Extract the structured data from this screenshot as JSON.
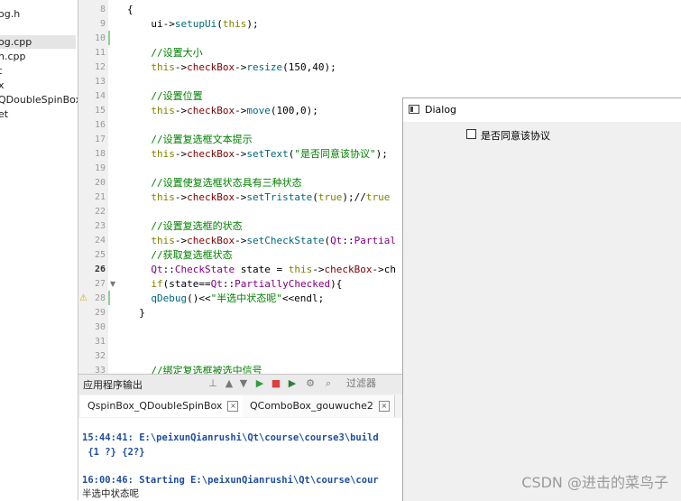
{
  "sidebar": {
    "files": [
      "og.h",
      "og.cpp",
      "n.cpp",
      "t",
      "x",
      "QDoubleSpinBox",
      "et"
    ]
  },
  "editor": {
    "lines": [
      {
        "n": "8",
        "text": "{"
      },
      {
        "n": "9",
        "text": "ui->setupUi(this);"
      },
      {
        "n": "10",
        "text": ""
      },
      {
        "n": "11",
        "text": "//设置大小"
      },
      {
        "n": "12",
        "text": "this->checkBox->resize(150,40);"
      },
      {
        "n": "13",
        "text": ""
      },
      {
        "n": "14",
        "text": "//设置位置"
      },
      {
        "n": "15",
        "text": "this->checkBox->move(100,0);"
      },
      {
        "n": "16",
        "text": ""
      },
      {
        "n": "17",
        "text": "//设置复选框文本提示"
      },
      {
        "n": "18",
        "text": "this->checkBox->setText(\"是否同意该协议\");"
      },
      {
        "n": "19",
        "text": ""
      },
      {
        "n": "20",
        "text": "//设置使复选框状态具有三种状态"
      },
      {
        "n": "21",
        "text": "this->checkBox->setTristate(true);//true"
      },
      {
        "n": "22",
        "text": ""
      },
      {
        "n": "23",
        "text": "//设置复选框的状态"
      },
      {
        "n": "24",
        "text": "this->checkBox->setCheckState(Qt::Partial"
      },
      {
        "n": "25",
        "text": "//获取复选框状态"
      },
      {
        "n": "26",
        "text": "Qt::CheckState state = this->checkBox->ch"
      },
      {
        "n": "27",
        "text": "if(state==Qt::PartiallyChecked){"
      },
      {
        "n": "28",
        "text": "qDebug()<<\"半选中状态呢\"<<endl;"
      },
      {
        "n": "29",
        "text": "}"
      },
      {
        "n": "30",
        "text": ""
      },
      {
        "n": "31",
        "text": ""
      },
      {
        "n": "32",
        "text": ""
      },
      {
        "n": "33",
        "text": "//绑定复选框被选中信号"
      }
    ]
  },
  "output_pane": {
    "title": "应用程序输出",
    "filter_placeholder": "过滤器",
    "tabs": [
      {
        "label": "QspinBox_QDoubleSpinBox"
      },
      {
        "label": "QComboBox_gouwuche2"
      }
    ],
    "lines": [
      {
        "text": "15:44:41: E:\\peixunQianrushi\\Qt\\course\\course3\\build",
        "style": "blue"
      },
      {
        "text": " {1 ?} {2?}",
        "style": "blue"
      },
      {
        "text": "16:00:46: Starting E:\\peixunQianrushi\\Qt\\course\\cour",
        "style": "blue"
      },
      {
        "text": "半选中状态呢",
        "style": "plain"
      }
    ]
  },
  "dialog": {
    "title": "Dialog",
    "checkbox_label": "是否同意该协议",
    "checkbox_state": "unchecked"
  },
  "watermark": "CSDN @进击的菜鸟子"
}
